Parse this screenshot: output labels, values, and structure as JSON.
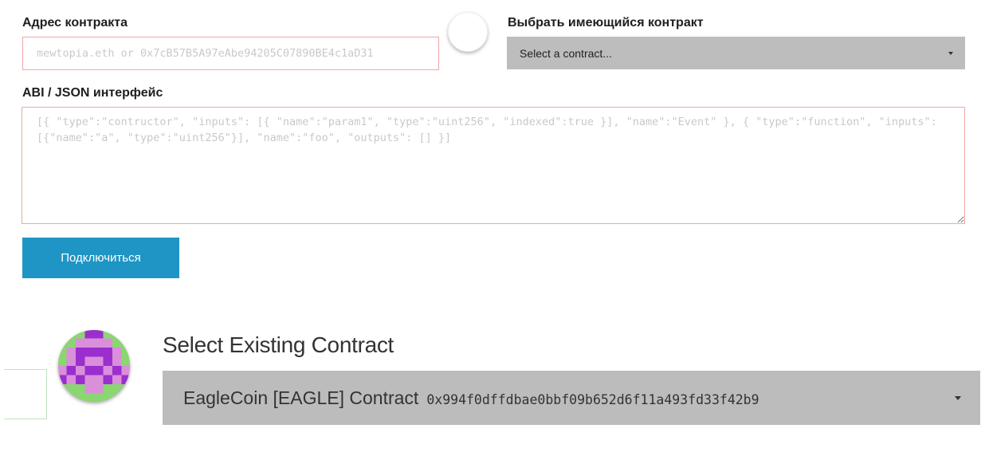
{
  "contract_form": {
    "address_label": "Адрес контракта",
    "address_value": "",
    "address_placeholder": "mewtopia.eth or 0x7cB57B5A97eAbe94205C07890BE4c1aD31",
    "existing_label": "Выбрать имеющийся контракт",
    "existing_select_value": "Select a contract...",
    "abi_label": "ABI / JSON интерфейс",
    "abi_value": "",
    "abi_placeholder": "[{ \"type\":\"contructor\", \"inputs\": [{ \"name\":\"param1\", \"type\":\"uint256\", \"indexed\":true }], \"name\":\"Event\" }, { \"type\":\"function\", \"inputs\": [{\"name\":\"a\", \"type\":\"uint256\"}], \"name\":\"foo\", \"outputs\": [] }]",
    "connect_button": "Подключиться"
  },
  "existing_contract_panel": {
    "heading": "Select Existing Contract",
    "selected_name": "EagleCoin [EAGLE] Contract",
    "selected_address": "0x994f0dffdbae0bbf09b652d6f11a493fd33f42b9"
  },
  "colors": {
    "input_error_border": "#f2a6a6",
    "select_background": "#bdbdbd",
    "button_blue": "#1e95c4",
    "identicon_purple": "#9b2ecf",
    "identicon_pink": "#d98fd9",
    "identicon_green": "#8ad671"
  },
  "icons": {
    "empty_identicon": "empty-identicon",
    "contract_identicon": "contract-identicon",
    "dropdown_caret": "caret-down-icon",
    "resize_grip": "resize-grip-icon"
  }
}
